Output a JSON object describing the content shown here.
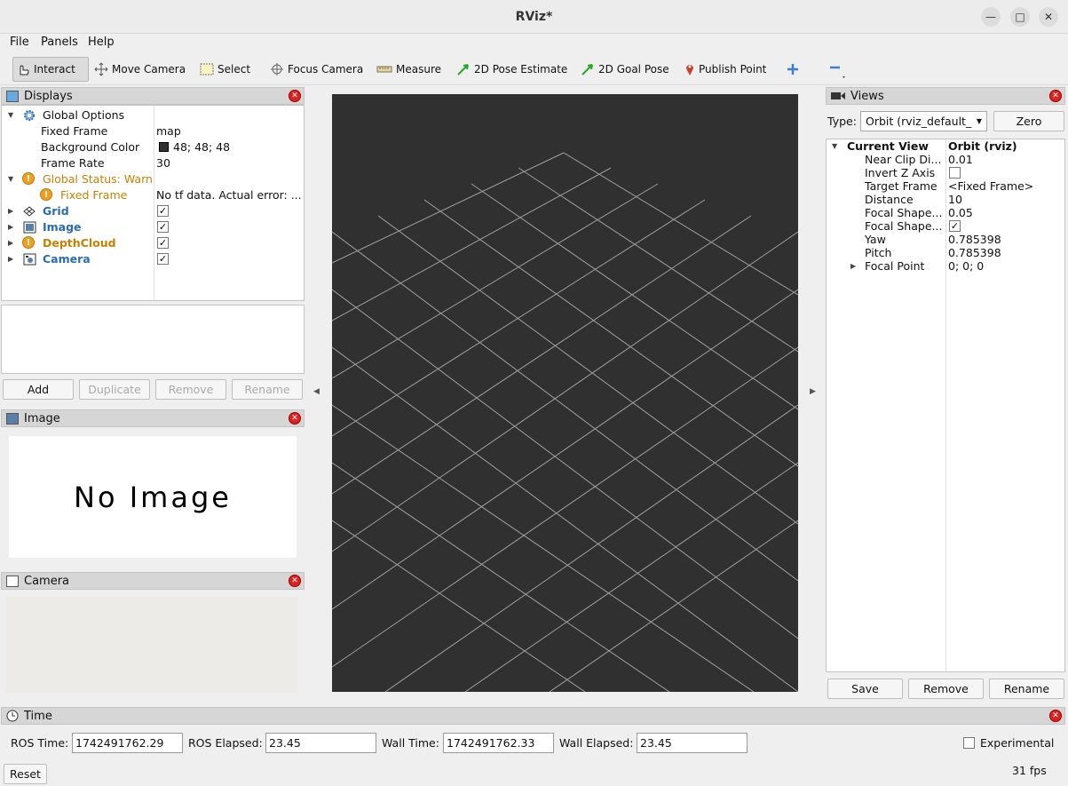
{
  "window": {
    "title": "RViz*"
  },
  "menu": [
    "File",
    "Panels",
    "Help"
  ],
  "toolbar": [
    {
      "label": "Interact",
      "icon": "hand-cursor-icon"
    },
    {
      "label": "Move Camera",
      "icon": "move-arrows-icon"
    },
    {
      "label": "Select",
      "icon": "select-box-icon"
    },
    {
      "label": "Focus Camera",
      "icon": "crosshair-icon"
    },
    {
      "label": "Measure",
      "icon": "ruler-icon"
    },
    {
      "label": "2D Pose Estimate",
      "icon": "green-arrow-icon"
    },
    {
      "label": "2D Goal Pose",
      "icon": "green-arrow-icon"
    },
    {
      "label": "Publish Point",
      "icon": "map-pin-icon"
    }
  ],
  "displays": {
    "title": "Displays",
    "global_options": "Global Options",
    "fixed_frame_label": "Fixed Frame",
    "fixed_frame_value": "map",
    "bg_color_label": "Background Color",
    "bg_color_value": "48; 48; 48",
    "bg_color_swatch": "#303030",
    "frame_rate_label": "Frame Rate",
    "frame_rate_value": "30",
    "global_status": "Global Status: Warn",
    "fixed_frame_status_label": "Fixed Frame",
    "fixed_frame_status_value": "No tf data.  Actual error: ...",
    "items": [
      {
        "label": "Grid",
        "checked": true,
        "status": "ok"
      },
      {
        "label": "Image",
        "checked": true,
        "status": "ok"
      },
      {
        "label": "DepthCloud",
        "checked": true,
        "status": "warn"
      },
      {
        "label": "Camera",
        "checked": true,
        "status": "ok"
      }
    ],
    "buttons": {
      "add": "Add",
      "duplicate": "Duplicate",
      "remove": "Remove",
      "rename": "Rename"
    }
  },
  "image_panel": {
    "title": "Image",
    "placeholder": "No Image"
  },
  "camera_panel": {
    "title": "Camera"
  },
  "views": {
    "title": "Views",
    "type_label": "Type:",
    "type_value": "Orbit (rviz_default_",
    "zero_button": "Zero",
    "header_name": "Current View",
    "header_value": "Orbit (rviz)",
    "props": [
      {
        "name": "Near Clip Di...",
        "value": "0.01"
      },
      {
        "name": "Invert Z Axis",
        "value": "",
        "checkbox": false
      },
      {
        "name": "Target Frame",
        "value": "<Fixed Frame>"
      },
      {
        "name": "Distance",
        "value": "10"
      },
      {
        "name": "Focal Shape...",
        "value": "0.05"
      },
      {
        "name": "Focal Shape...",
        "value": "",
        "checkbox": true
      },
      {
        "name": "Yaw",
        "value": "0.785398"
      },
      {
        "name": "Pitch",
        "value": "0.785398"
      },
      {
        "name": "Focal Point",
        "value": "0; 0; 0"
      }
    ],
    "buttons": {
      "save": "Save",
      "remove": "Remove",
      "rename": "Rename"
    }
  },
  "time_panel": {
    "title": "Time",
    "ros_time_label": "ROS Time:",
    "ros_time": "1742491762.29",
    "ros_elapsed_label": "ROS Elapsed:",
    "ros_elapsed": "23.45",
    "wall_time_label": "Wall Time:",
    "wall_time": "1742491762.33",
    "wall_elapsed_label": "Wall Elapsed:",
    "wall_elapsed": "23.45",
    "experimental_label": "Experimental",
    "experimental_checked": false,
    "reset": "Reset",
    "fps": "31 fps"
  },
  "colors": {
    "viewport_bg": "#303030",
    "grid_line": "#a0a0a0",
    "accent_blue": "#2a6cb3",
    "warn_orange": "#c88000"
  }
}
